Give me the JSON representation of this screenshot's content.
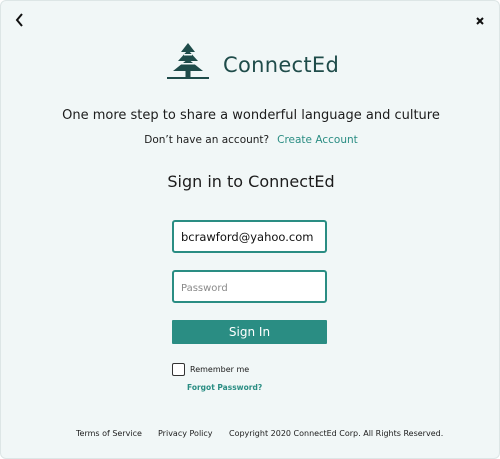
{
  "nav": {
    "back_icon": "chevron-left-icon",
    "close_icon": "close-icon"
  },
  "brand": {
    "name": "ConnectEd",
    "logo_icon": "pine-tree-icon",
    "color": "#1f4c4a"
  },
  "intro": {
    "tagline": "One more step to share a wonderful language and culture",
    "no_account_text": "Don’t have an account?",
    "create_account_label": "Create Account"
  },
  "form": {
    "title": "Sign in to ConnectEd",
    "email_value": "bcrawford@yahoo.com",
    "password_placeholder": "Password",
    "submit_label": "Sign In",
    "remember_label": "Remember me",
    "remember_checked": false,
    "forgot_label": "Forgot Password?"
  },
  "footer": {
    "terms": "Terms of Service",
    "privacy": "Privacy Policy",
    "copyright": "Copyright 2020 ConnectEd Corp. All Rights Reserved."
  },
  "colors": {
    "accent": "#2a8d83",
    "background": "#f1f7f7"
  }
}
